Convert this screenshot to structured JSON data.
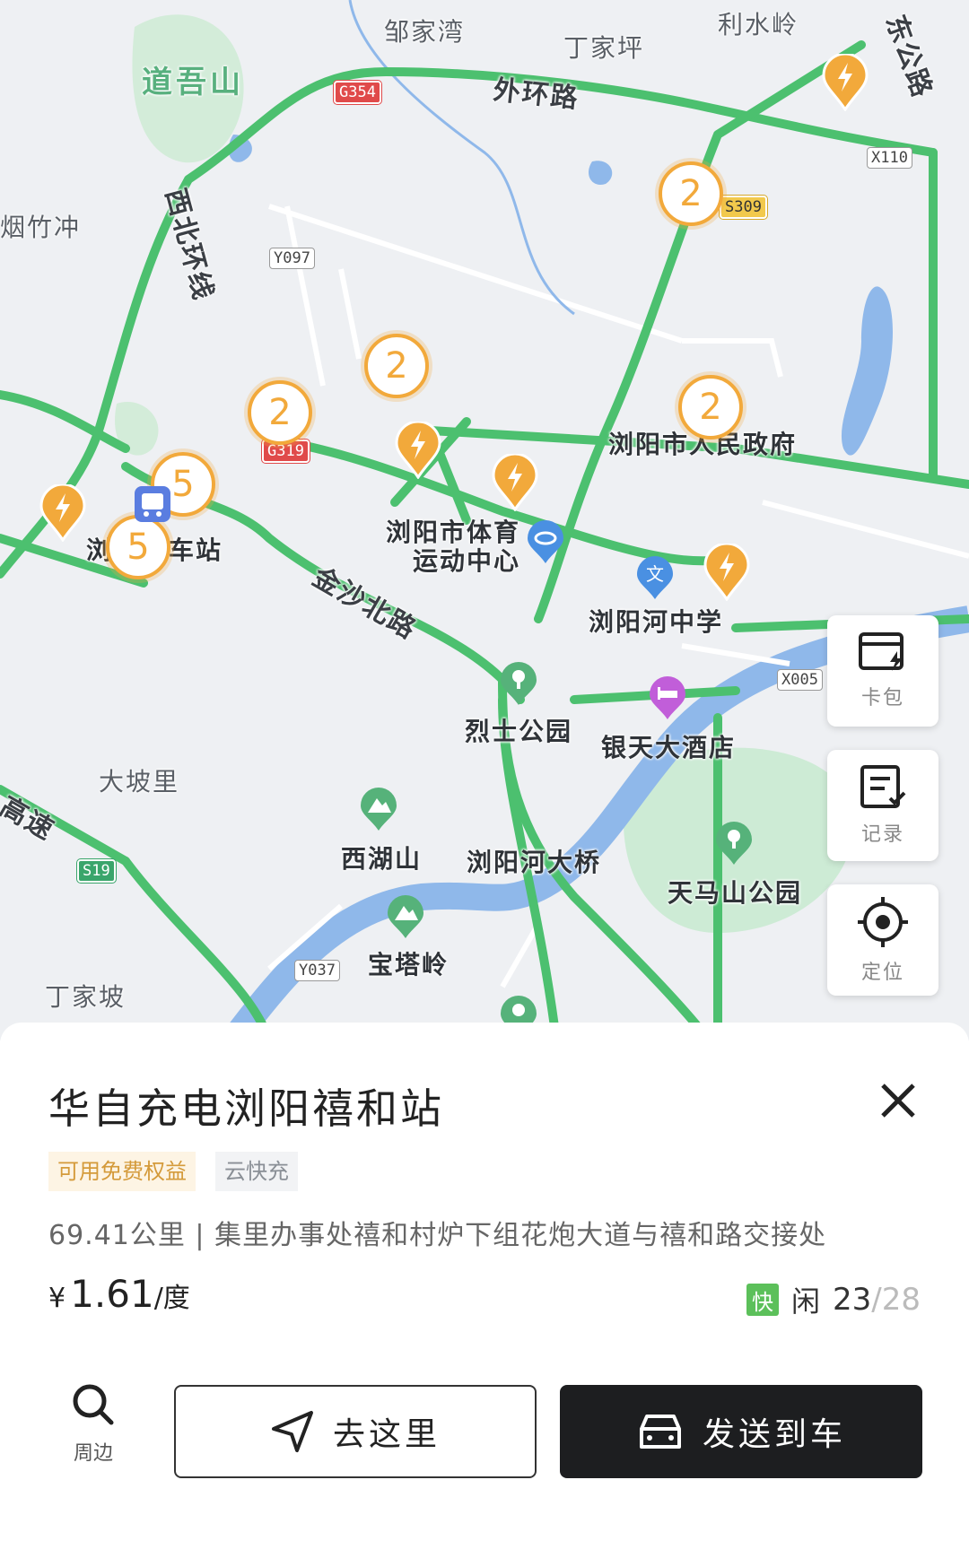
{
  "map": {
    "labels": {
      "zoujiawan": "邹家湾",
      "dingjiaping": "丁家坪",
      "lishuiling": "利水岭",
      "daowushan": "道吾山",
      "waihuanlu": "外环路",
      "dong_gonglu": "东公路",
      "yanzhuchong": "烟竹冲",
      "xibeihuanxian": "西北环线",
      "liuyang_gov": "浏阳市人民政府",
      "liu_left": "浏",
      "chezhan": "车站",
      "tiyu": "浏阳市体育",
      "tiyu2": "运动中心",
      "jinsha": "金沙北路",
      "liuyanghe_school": "浏阳河中学",
      "lieshi": "烈士公园",
      "yintian": "银天大酒店",
      "dapoli": "大坡里",
      "gaosu": "高速",
      "xihushan": "西湖山",
      "liuyanghe_bridge": "浏阳河大桥",
      "tianmashan": "天马山公园",
      "baotaling": "宝塔岭",
      "dingjiapo": "丁家坡"
    },
    "shields": {
      "g354": "G354",
      "x110": "X110",
      "s309": "S309",
      "y097": "Y097",
      "g319": "G319",
      "x005": "X005",
      "s19": "S19",
      "y037": "Y037"
    },
    "clusters": [
      "2",
      "2",
      "2",
      "2",
      "5",
      "5"
    ]
  },
  "side_buttons": {
    "wallet": "卡包",
    "records": "记录",
    "locate": "定位"
  },
  "station": {
    "name": "华自充电浏阳禧和站",
    "tags": [
      "可用免费权益",
      "云快充"
    ],
    "address": "69.41公里 | 集里办事处禧和村炉下组花炮大道与禧和路交接处",
    "price_currency": "¥",
    "price_value": "1.61",
    "price_unit": "/度",
    "fast_badge": "快",
    "idle_label": "闲",
    "available": "23",
    "total": "/28"
  },
  "actions": {
    "nearby": "周边",
    "go": "去这里",
    "send": "发送到车"
  },
  "colors": {
    "road": "#4cc06f",
    "water": "#8fb8ea",
    "park": "#cdebd5",
    "pin": "#f2a93b",
    "dark_button": "#1d1e20"
  }
}
